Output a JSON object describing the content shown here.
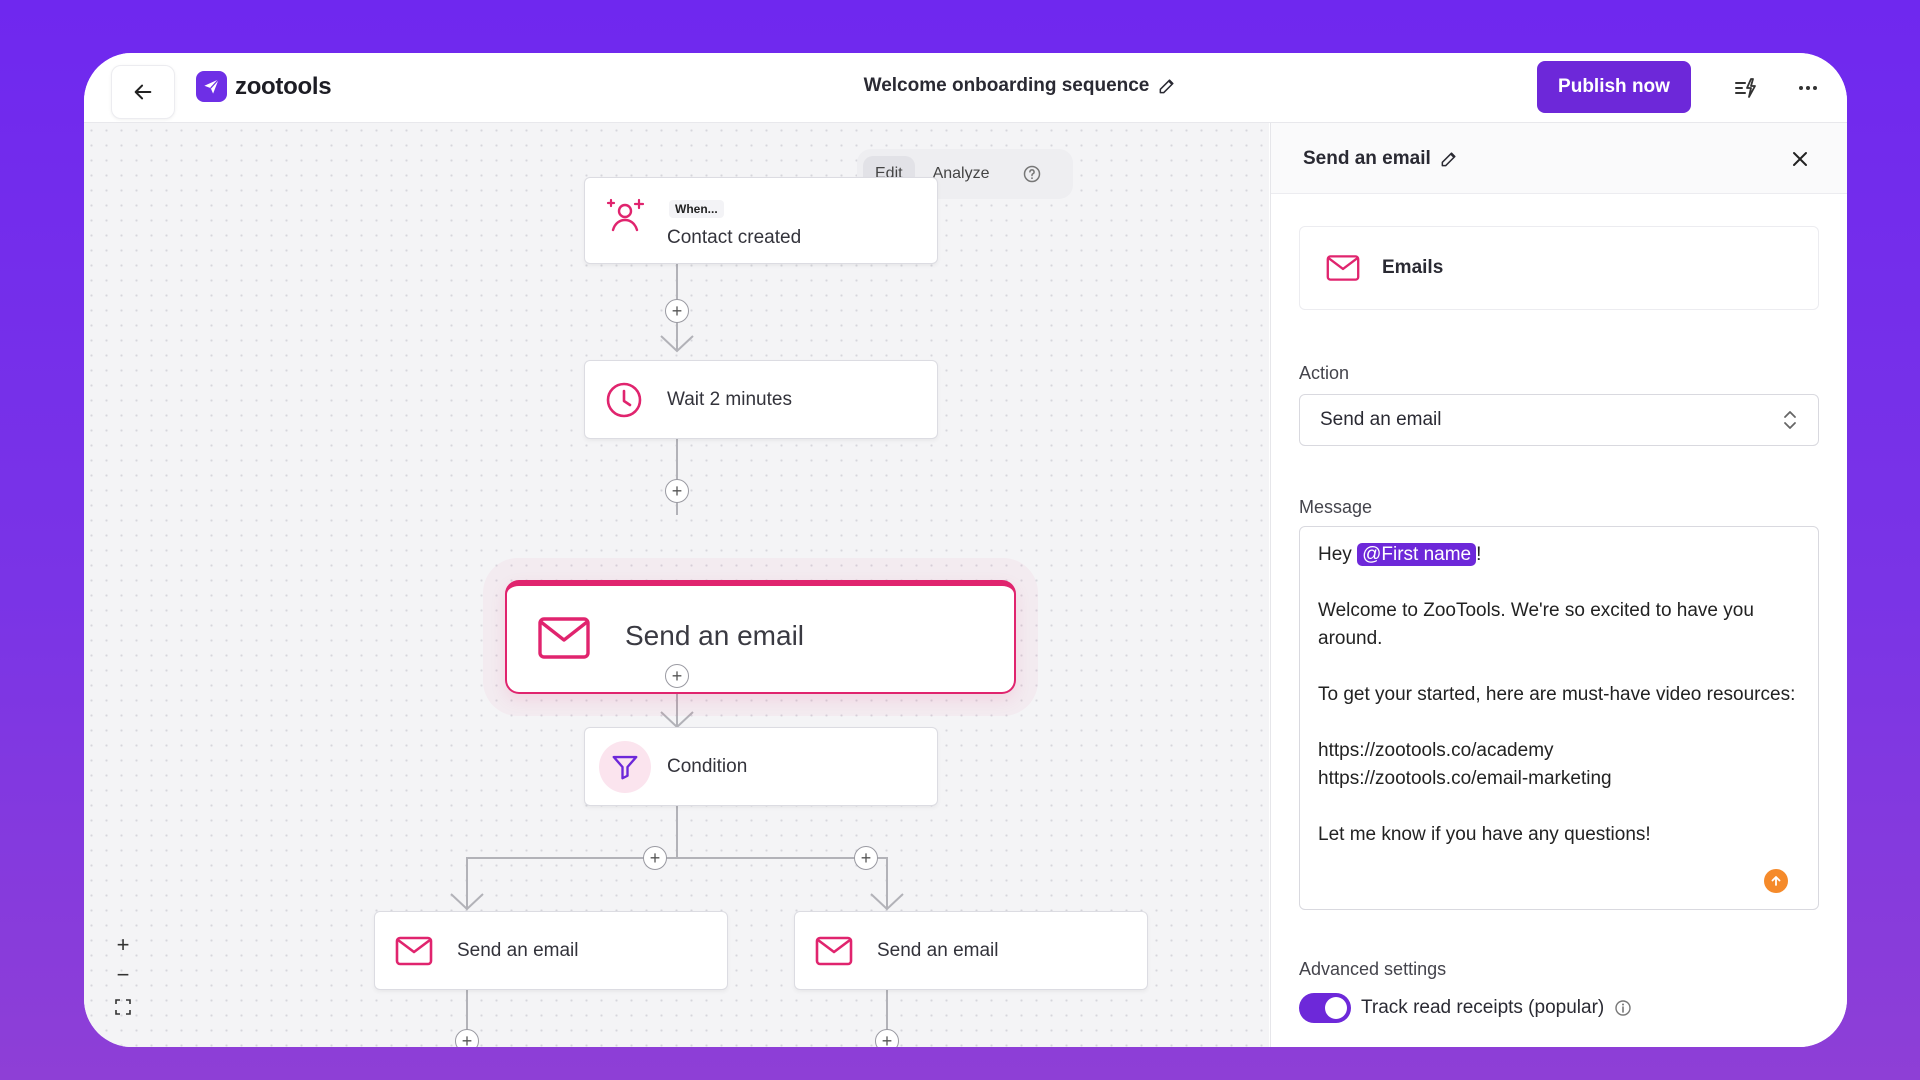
{
  "brand": {
    "name": "zootools",
    "accent": "#6d28d9",
    "pink": "#e0246e"
  },
  "header": {
    "title": "Welcome onboarding sequence",
    "publish_label": "Publish now"
  },
  "canvas": {
    "modes": [
      "Edit",
      "Analyze"
    ],
    "active_mode": "Edit",
    "nodes": {
      "trigger_kicker": "When...",
      "trigger_label": "Contact created",
      "wait_label": "Wait 2 minutes",
      "email_selected_label": "Send an email",
      "condition_label": "Condition",
      "branch_left_label": "Send an email",
      "branch_right_label": "Send an email"
    },
    "zoom_in": "+",
    "zoom_out": "−"
  },
  "panel": {
    "title": "Send an email",
    "app_card_label": "Emails",
    "action_label": "Action",
    "action_value": "Send an email",
    "message_label": "Message",
    "message": {
      "greeting": "Hey",
      "mention": "@First name",
      "greeting_end": "!",
      "line1": "Welcome to ZooTools. We're so excited to have you around.",
      "line2": "To get your started, here are must-have video resources:",
      "link1": "https://zootools.co/academy",
      "link2": "https://zootools.co/email-marketing",
      "line3": "Let me know if you have any questions!"
    },
    "advanced_label": "Advanced settings",
    "track_label": "Track read receipts (popular)",
    "track_enabled": true
  }
}
